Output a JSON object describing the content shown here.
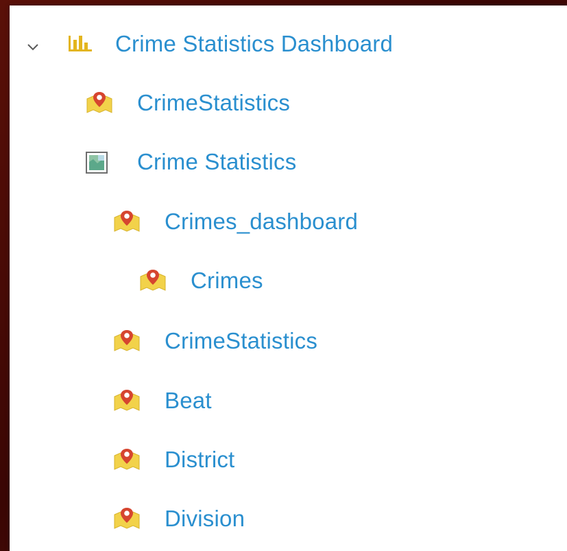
{
  "tree": {
    "root": {
      "label": "Crime Statistics Dashboard",
      "icon": "dashboard-icon",
      "expanded": true
    },
    "items": [
      {
        "label": "CrimeStatistics",
        "icon": "feature-layer-icon"
      },
      {
        "label": "Crime Statistics",
        "icon": "web-map-icon"
      },
      {
        "label": "Crimes_dashboard",
        "icon": "feature-layer-icon"
      },
      {
        "label": "Crimes",
        "icon": "feature-layer-icon"
      },
      {
        "label": "CrimeStatistics",
        "icon": "feature-layer-icon"
      },
      {
        "label": "Beat",
        "icon": "feature-layer-icon"
      },
      {
        "label": "District",
        "icon": "feature-layer-icon"
      },
      {
        "label": "Division",
        "icon": "feature-layer-icon"
      }
    ]
  },
  "colors": {
    "link": "#2a8fcf",
    "layer_icon_fill": "#f2d24a",
    "layer_icon_marker": "#d6452f",
    "dashboard_icon": "#e3b51e",
    "background": "#4a0c06"
  }
}
